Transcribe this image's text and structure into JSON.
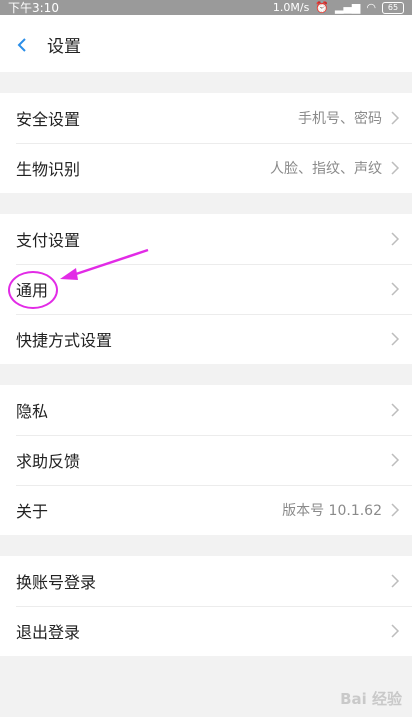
{
  "status_bar": {
    "time": "下午3:10",
    "network_speed": "1.0M/s",
    "battery": "65"
  },
  "header": {
    "title": "设置"
  },
  "groups": [
    {
      "items": [
        {
          "label": "安全设置",
          "value": "手机号、密码"
        },
        {
          "label": "生物识别",
          "value": "人脸、指纹、声纹"
        }
      ]
    },
    {
      "items": [
        {
          "label": "支付设置",
          "value": ""
        },
        {
          "label": "通用",
          "value": ""
        },
        {
          "label": "快捷方式设置",
          "value": ""
        }
      ]
    },
    {
      "items": [
        {
          "label": "隐私",
          "value": ""
        },
        {
          "label": "求助反馈",
          "value": ""
        },
        {
          "label": "关于",
          "value": "版本号 10.1.62"
        }
      ]
    },
    {
      "items": [
        {
          "label": "换账号登录",
          "value": ""
        },
        {
          "label": "退出登录",
          "value": ""
        }
      ]
    }
  ],
  "colors": {
    "annotation": "#e22be6",
    "back_arrow": "#2a8ee8"
  },
  "watermark": "Bai 经验"
}
